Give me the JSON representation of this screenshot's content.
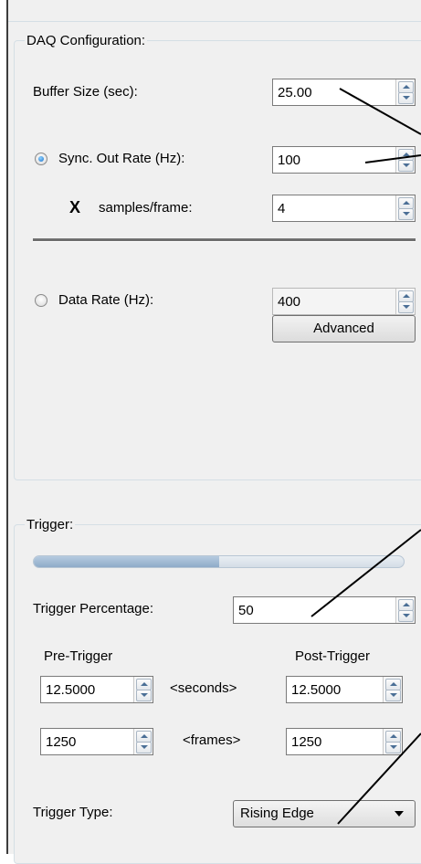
{
  "daq": {
    "legend": "DAQ Configuration:",
    "buffer_size": {
      "label": "Buffer Size (sec):",
      "value": "25.00"
    },
    "sync_out": {
      "label": "Sync. Out Rate (Hz):",
      "value": "100",
      "selected": true
    },
    "samples_frame": {
      "multiplier": "X",
      "label": "samples/frame:",
      "value": "4"
    },
    "data_rate": {
      "label": "Data Rate (Hz):",
      "value": "400",
      "selected": false
    },
    "advanced_label": "Advanced"
  },
  "trigger": {
    "legend": "Trigger:",
    "percentage": {
      "label": "Trigger Percentage:",
      "value": "50",
      "fill_fraction": 0.5
    },
    "pre_label": "Pre-Trigger",
    "post_label": "Post-Trigger",
    "seconds_label": "<seconds>",
    "frames_label": "<frames>",
    "pre_seconds": "12.5000",
    "post_seconds": "12.5000",
    "pre_frames": "1250",
    "post_frames": "1250",
    "type": {
      "label": "Trigger Type:",
      "value": "Rising Edge"
    }
  },
  "colors": {
    "accent": "#1a6fc9",
    "panel": "#f0f0f0",
    "border": "#d5dfe5"
  }
}
